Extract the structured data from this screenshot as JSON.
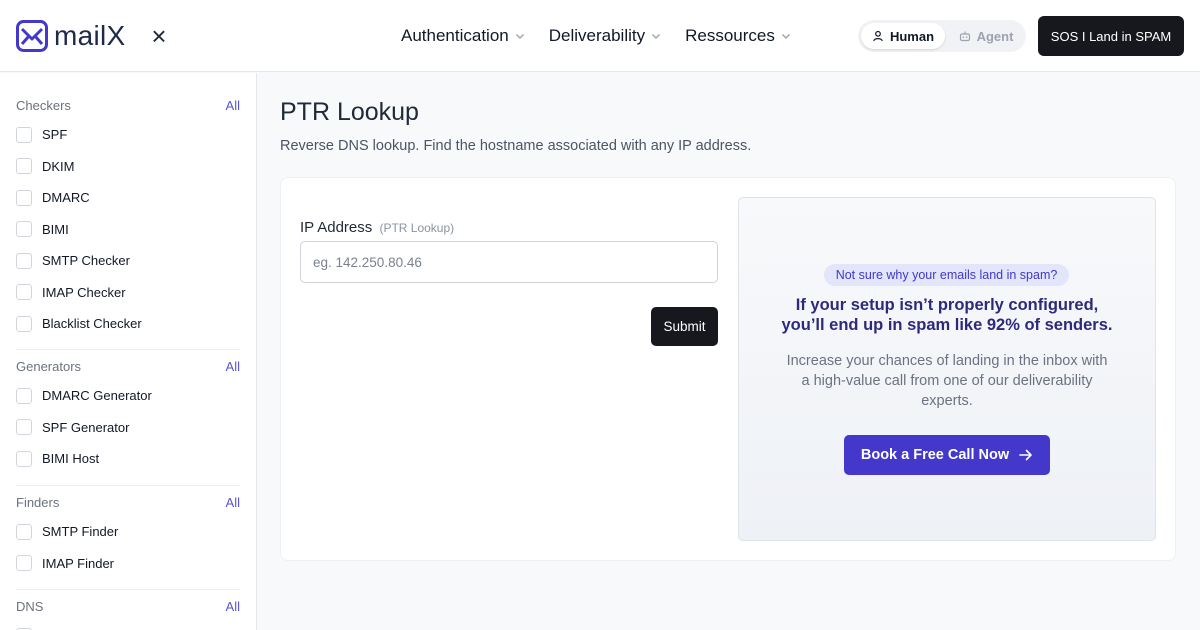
{
  "header": {
    "logo_text": "mailX",
    "nav": [
      {
        "label": "Authentication"
      },
      {
        "label": "Deliverability"
      },
      {
        "label": "Ressources"
      }
    ],
    "mode": {
      "human": "Human",
      "agent": "Agent",
      "selected": "Human"
    },
    "sos_button": "SOS I Land in SPAM"
  },
  "sidebar": {
    "all_label": "All",
    "sections": [
      {
        "title": "Checkers",
        "items": [
          "SPF",
          "DKIM",
          "DMARC",
          "BIMI",
          "SMTP Checker",
          "IMAP Checker",
          "Blacklist Checker"
        ]
      },
      {
        "title": "Generators",
        "items": [
          "DMARC Generator",
          "SPF Generator",
          "BIMI Host"
        ]
      },
      {
        "title": "Finders",
        "items": [
          "SMTP Finder",
          "IMAP Finder"
        ]
      },
      {
        "title": "DNS",
        "items": []
      }
    ]
  },
  "main": {
    "title": "PTR Lookup",
    "subtitle": "Reverse DNS lookup. Find the hostname associated with any IP address.",
    "form": {
      "label": "IP Address",
      "label_hint": "(PTR Lookup)",
      "placeholder": "eg. 142.250.80.46",
      "value": "",
      "submit_label": "Submit"
    },
    "promo": {
      "badge": "Not sure why your emails land in spam?",
      "title_line1": "If your setup isn’t properly configured,",
      "title_line2": "you’ll end up in spam like 92% of senders.",
      "text_line1": "Increase your chances of landing in the inbox with",
      "text_line2": "a high-value call from one of our deliverability",
      "text_line3": "experts.",
      "cta": "Book a Free Call Now"
    }
  },
  "colors": {
    "accent": "#4338ca",
    "dark_button": "#16181d",
    "link": "#5b54d6"
  }
}
